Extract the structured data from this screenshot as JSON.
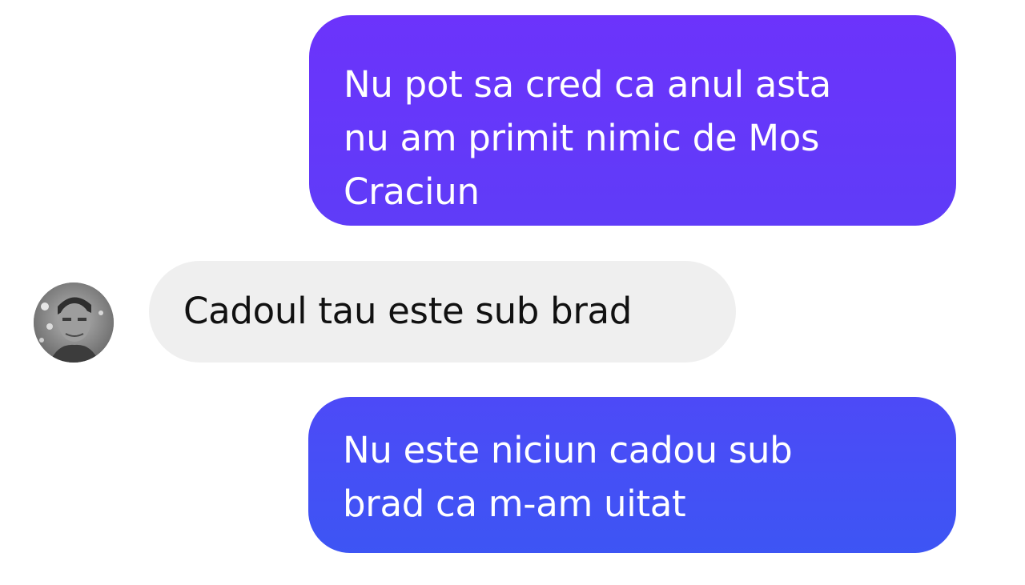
{
  "conversation": {
    "messages": [
      {
        "direction": "outgoing",
        "text": "Nu pot sa cred ca anul asta\nnu am primit nimic de Mos\nCraciun"
      },
      {
        "direction": "incoming",
        "text": "Cadoul tau este sub brad"
      },
      {
        "direction": "outgoing",
        "text": "Nu este niciun cadou sub\nbrad ca m-am uitat"
      }
    ]
  },
  "colors": {
    "outgoing_bubble_top": "#6c33fb",
    "outgoing_bubble_bottom": "#3d55f4",
    "incoming_bubble": "#efefef",
    "incoming_text": "#111111",
    "outgoing_text": "#ffffff"
  },
  "icons": {
    "avatar": "contact-avatar-photo"
  }
}
